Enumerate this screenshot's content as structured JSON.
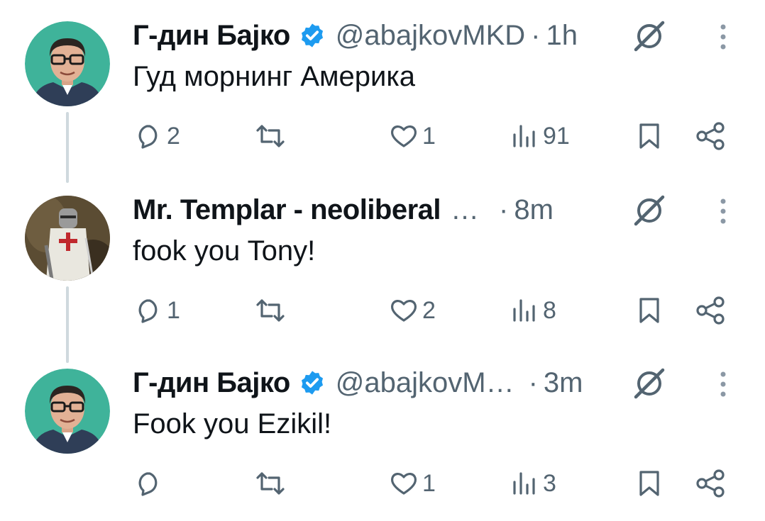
{
  "colors": {
    "accent": "#1d9bf0",
    "muted": "#536471",
    "text": "#0f1419",
    "thread_line": "#cfd9de"
  },
  "tweets": [
    {
      "name": "Г-дин Бајко",
      "verified": true,
      "handle": "@abajkovMKD",
      "dot": "·",
      "time": "1h",
      "name_ellipsis": "",
      "text": "Гуд морнинг Америка",
      "replies": "2",
      "reposts": "",
      "likes": "1",
      "views": "91",
      "avatar": "portrait-man-glasses"
    },
    {
      "name": "Mr. Templar - neoliberal",
      "verified": false,
      "handle": "",
      "dot": "·",
      "time": "8m",
      "name_ellipsis": "…",
      "text": "fook you Tony!",
      "replies": "1",
      "reposts": "",
      "likes": "2",
      "views": "8",
      "avatar": "templar-knight"
    },
    {
      "name": "Г-дин Бајко",
      "verified": true,
      "handle": "@abajkovM…",
      "dot": "·",
      "time": "3m",
      "name_ellipsis": "",
      "text": "Fook you Ezikil!",
      "replies": "",
      "reposts": "",
      "likes": "1",
      "views": "3",
      "avatar": "portrait-man-glasses"
    }
  ],
  "icons": [
    "reply-icon",
    "repost-icon",
    "like-icon",
    "views-icon",
    "bookmark-icon",
    "share-icon",
    "grok-icon",
    "more-icon",
    "verified-badge-icon"
  ]
}
